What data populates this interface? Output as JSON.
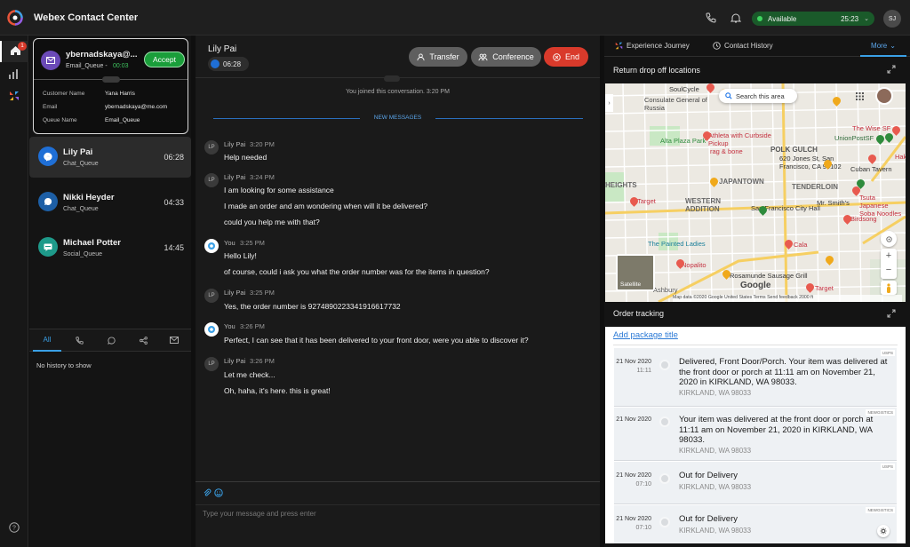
{
  "app": {
    "title": "Webex Contact Center"
  },
  "topbar": {
    "status_label": "Available",
    "status_timer": "25:23",
    "avatar_initials": "SJ"
  },
  "rail": {
    "notification_count": "1"
  },
  "incoming": {
    "name": "ybernadskaya@...",
    "queue": "Email_Queue -",
    "timer": "00:03",
    "accept_label": "Accept",
    "details": [
      {
        "label": "Customer Name",
        "value": "Yana Harris"
      },
      {
        "label": "Email",
        "value": "ybernadskaya@me.com"
      },
      {
        "label": "Queue Name",
        "value": "Email_Queue"
      }
    ]
  },
  "contacts": [
    {
      "name": "Lily Pai",
      "queue": "Chat_Queue",
      "time": "06:28",
      "color": "#1f6fd6"
    },
    {
      "name": "Nikki Heyder",
      "queue": "Chat_Queue",
      "time": "04:33",
      "color": "#1d5fa6"
    },
    {
      "name": "Michael Potter",
      "queue": "Social_Queue",
      "time": "14:45",
      "color": "#1e9a8a"
    }
  ],
  "history": {
    "tabs": [
      "All"
    ],
    "empty_text": "No history to show"
  },
  "chat": {
    "contact_name": "Lily Pai",
    "timer": "06:28",
    "transfer_label": "Transfer",
    "conference_label": "Conference",
    "end_label": "End",
    "joined_text": "You joined this conversation. 3:20 PM",
    "new_messages_label": "NEW MESSAGES",
    "composer_placeholder": "Type your message and press enter",
    "messages": [
      {
        "sender": "Lily Pai",
        "initials": "LP",
        "time": "3:20 PM",
        "lines": [
          "Help needed"
        ]
      },
      {
        "sender": "Lily Pai",
        "initials": "LP",
        "time": "3:24 PM",
        "lines": [
          "I am looking for some assistance",
          "I made an order and am wondering when will it be delivered?",
          "could you help me with that?"
        ]
      },
      {
        "sender": "You",
        "initials": "",
        "time": "3:25 PM",
        "lines": [
          "Hello Lily!",
          "of course, could i ask you what the order number was for the items in question?"
        ]
      },
      {
        "sender": "Lily Pai",
        "initials": "LP",
        "time": "3:25 PM",
        "lines": [
          "Yes, the order number is 927489022334191661773​2"
        ]
      },
      {
        "sender": "You",
        "initials": "",
        "time": "3:26 PM",
        "lines": [
          "Perfect, I can see that it has been delivered to your front door, were you able to discover it?"
        ]
      },
      {
        "sender": "Lily Pai",
        "initials": "LP",
        "time": "3:26 PM",
        "lines": [
          "Let me check...",
          "Oh, haha, it's here. this is great!"
        ]
      }
    ]
  },
  "right": {
    "tabs": {
      "journey": "Experience Journey",
      "history": "Contact History",
      "more": "More"
    },
    "map_title": "Return drop off locations",
    "map_search": "Search this area",
    "map_satellite": "Satellite",
    "map_footer": "Map data ©2020 Google   United States   Terms   Send feedback   2000 ft",
    "map_google": "Google",
    "map_labels": [
      {
        "text": "SoulCycle",
        "color": "#333"
      },
      {
        "text": "Consulate General of Russia",
        "color": "#444"
      },
      {
        "text": "Alta Plaza Park",
        "color": "#2e8b3c"
      },
      {
        "text": "Athleta with Curbside Pickup",
        "color": "#c4303f"
      },
      {
        "text": "rag & bone",
        "color": "#c4303f"
      },
      {
        "text": "POLK GULCH",
        "color": "#555"
      },
      {
        "text": "620 Jones St, San Francisco, CA 94102",
        "color": "#333"
      },
      {
        "text": "UnionPostSF",
        "color": "#2e6b3a"
      },
      {
        "text": "Cuban Tavern",
        "color": "#333"
      },
      {
        "text": "HEIGHTS",
        "color": "#666"
      },
      {
        "text": "JAPANTOWN",
        "color": "#666"
      },
      {
        "text": "TENDERLOIN",
        "color": "#666"
      },
      {
        "text": "WESTERN ADDITION",
        "color": "#666"
      },
      {
        "text": "San Francisco City Hall",
        "color": "#333"
      },
      {
        "text": "Mr. Smith's",
        "color": "#333"
      },
      {
        "text": "Target",
        "color": "#c4303f"
      },
      {
        "text": "Birdsong",
        "color": "#c4303f"
      },
      {
        "text": "Tsuta Japanese Soba Noodles",
        "color": "#c4303f"
      },
      {
        "text": "The Painted Ladies",
        "color": "#1a7f9a"
      },
      {
        "text": "Cala",
        "color": "#c4303f"
      },
      {
        "text": "Nopalito",
        "color": "#c4303f"
      },
      {
        "text": "Rosamunde Sausage Grill",
        "color": "#333"
      },
      {
        "text": "Target",
        "color": "#c4303f"
      },
      {
        "text": "The Wise SF",
        "color": "#c4303f"
      },
      {
        "text": "Hakk",
        "color": "#c4303f"
      },
      {
        "text": "Ashbury",
        "color": "#555"
      }
    ],
    "order_title": "Order tracking",
    "add_package": "Add package title",
    "events": [
      {
        "date": "21 Nov 2020",
        "time": "11:11",
        "main": "Delivered, Front Door/Porch. Your item was delivered at the front door or porch at 11:11 am on November 21, 2020 in KIRKLAND, WA 98033.",
        "sub": "KIRKLAND, WA 98033",
        "badge": "USPS"
      },
      {
        "date": "21 Nov 2020",
        "time": "",
        "main": "Your item was delivered at the front door or porch at 11:11 am on November 21, 2020 in KIRKLAND, WA 98033.",
        "sub": "KIRKLAND, WA 98033",
        "badge": "NEWGISTICS"
      },
      {
        "date": "21 Nov 2020",
        "time": "07:10",
        "main": "Out for Delivery",
        "sub": "KIRKLAND, WA 98033",
        "badge": "USPS"
      },
      {
        "date": "21 Nov 2020",
        "time": "07:10",
        "main": "Out for Delivery",
        "sub": "KIRKLAND, WA 98033",
        "badge": "NEWGISTICS"
      }
    ]
  },
  "colors": {
    "accent_green": "#1a9e3a",
    "end_red": "#d93a2b",
    "link_blue": "#2c7ad6"
  }
}
